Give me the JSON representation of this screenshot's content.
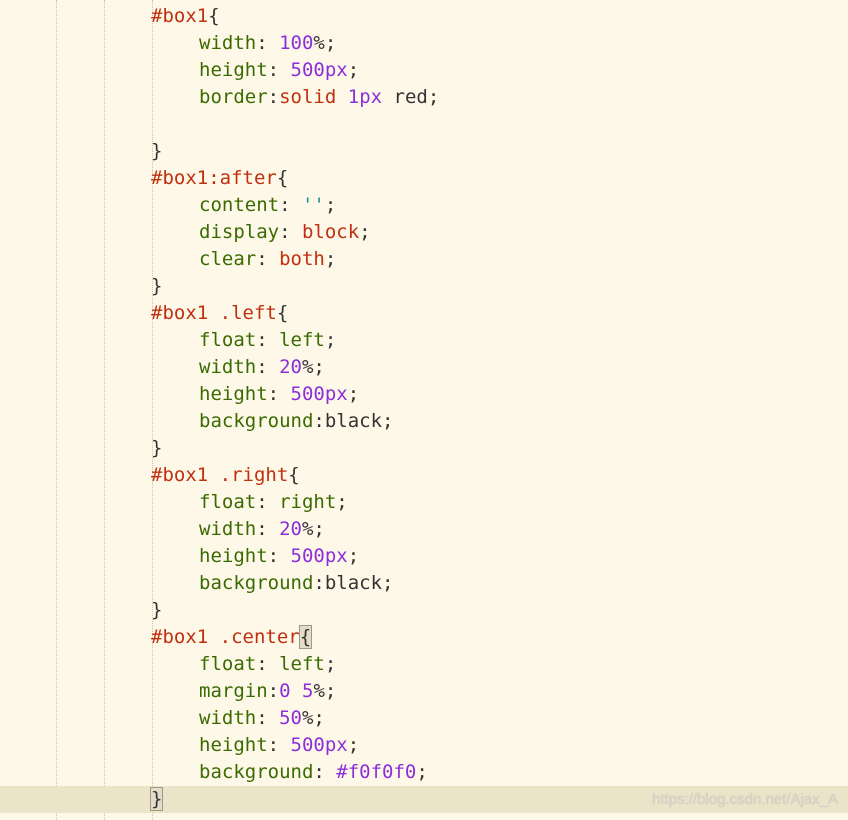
{
  "editor": {
    "lines": [
      {
        "tokens": [
          {
            "t": "sel",
            "v": "#box1"
          },
          {
            "t": "brace",
            "v": "{"
          }
        ]
      },
      {
        "tokens": [
          {
            "t": "prop",
            "v": "width"
          },
          {
            "t": "punct",
            "v": ": "
          },
          {
            "t": "num",
            "v": "100"
          },
          {
            "t": "punct",
            "v": "%;"
          }
        ]
      },
      {
        "tokens": [
          {
            "t": "prop",
            "v": "height"
          },
          {
            "t": "punct",
            "v": ": "
          },
          {
            "t": "num",
            "v": "500px"
          },
          {
            "t": "punct",
            "v": ";"
          }
        ]
      },
      {
        "tokens": [
          {
            "t": "prop",
            "v": "border"
          },
          {
            "t": "punct",
            "v": ":"
          },
          {
            "t": "kw",
            "v": "solid"
          },
          {
            "t": "punct",
            "v": " "
          },
          {
            "t": "num",
            "v": "1px"
          },
          {
            "t": "punct",
            "v": " "
          },
          {
            "t": "plain",
            "v": "red"
          },
          {
            "t": "punct",
            "v": ";"
          }
        ]
      },
      {
        "tokens": []
      },
      {
        "tokens": [
          {
            "t": "brace",
            "v": "}"
          }
        ]
      },
      {
        "tokens": [
          {
            "t": "sel",
            "v": "#box1:after"
          },
          {
            "t": "brace",
            "v": "{"
          }
        ]
      },
      {
        "tokens": [
          {
            "t": "prop",
            "v": "content"
          },
          {
            "t": "punct",
            "v": ": "
          },
          {
            "t": "str",
            "v": "''"
          },
          {
            "t": "punct",
            "v": ";"
          }
        ]
      },
      {
        "tokens": [
          {
            "t": "prop",
            "v": "display"
          },
          {
            "t": "punct",
            "v": ": "
          },
          {
            "t": "kw",
            "v": "block"
          },
          {
            "t": "punct",
            "v": ";"
          }
        ]
      },
      {
        "tokens": [
          {
            "t": "prop",
            "v": "clear"
          },
          {
            "t": "punct",
            "v": ": "
          },
          {
            "t": "kw",
            "v": "both"
          },
          {
            "t": "punct",
            "v": ";"
          }
        ]
      },
      {
        "tokens": [
          {
            "t": "brace",
            "v": "}"
          }
        ]
      },
      {
        "tokens": [
          {
            "t": "sel",
            "v": "#box1 .left"
          },
          {
            "t": "brace",
            "v": "{"
          }
        ]
      },
      {
        "tokens": [
          {
            "t": "prop",
            "v": "float"
          },
          {
            "t": "punct",
            "v": ": "
          },
          {
            "t": "prop",
            "v": "left"
          },
          {
            "t": "punct",
            "v": ";"
          }
        ]
      },
      {
        "tokens": [
          {
            "t": "prop",
            "v": "width"
          },
          {
            "t": "punct",
            "v": ": "
          },
          {
            "t": "num",
            "v": "20"
          },
          {
            "t": "punct",
            "v": "%;"
          }
        ]
      },
      {
        "tokens": [
          {
            "t": "prop",
            "v": "height"
          },
          {
            "t": "punct",
            "v": ": "
          },
          {
            "t": "num",
            "v": "500px"
          },
          {
            "t": "punct",
            "v": ";"
          }
        ]
      },
      {
        "tokens": [
          {
            "t": "prop",
            "v": "background"
          },
          {
            "t": "punct",
            "v": ":"
          },
          {
            "t": "plain",
            "v": "black"
          },
          {
            "t": "punct",
            "v": ";"
          }
        ]
      },
      {
        "tokens": [
          {
            "t": "brace",
            "v": "}"
          }
        ]
      },
      {
        "tokens": [
          {
            "t": "sel",
            "v": "#box1 .right"
          },
          {
            "t": "brace",
            "v": "{"
          }
        ]
      },
      {
        "tokens": [
          {
            "t": "prop",
            "v": "float"
          },
          {
            "t": "punct",
            "v": ": "
          },
          {
            "t": "prop",
            "v": "right"
          },
          {
            "t": "punct",
            "v": ";"
          }
        ]
      },
      {
        "tokens": [
          {
            "t": "prop",
            "v": "width"
          },
          {
            "t": "punct",
            "v": ": "
          },
          {
            "t": "num",
            "v": "20"
          },
          {
            "t": "punct",
            "v": "%;"
          }
        ]
      },
      {
        "tokens": [
          {
            "t": "prop",
            "v": "height"
          },
          {
            "t": "punct",
            "v": ": "
          },
          {
            "t": "num",
            "v": "500px"
          },
          {
            "t": "punct",
            "v": ";"
          }
        ]
      },
      {
        "tokens": [
          {
            "t": "prop",
            "v": "background"
          },
          {
            "t": "punct",
            "v": ":"
          },
          {
            "t": "plain",
            "v": "black"
          },
          {
            "t": "punct",
            "v": ";"
          }
        ]
      },
      {
        "tokens": [
          {
            "t": "brace",
            "v": "}"
          }
        ]
      },
      {
        "tokens": [
          {
            "t": "sel",
            "v": "#box1 .center"
          },
          {
            "t": "match",
            "v": "{"
          }
        ]
      },
      {
        "tokens": [
          {
            "t": "prop",
            "v": "float"
          },
          {
            "t": "punct",
            "v": ": "
          },
          {
            "t": "prop",
            "v": "left"
          },
          {
            "t": "punct",
            "v": ";"
          }
        ]
      },
      {
        "tokens": [
          {
            "t": "prop",
            "v": "margin"
          },
          {
            "t": "punct",
            "v": ":"
          },
          {
            "t": "num",
            "v": "0"
          },
          {
            "t": "punct",
            "v": " "
          },
          {
            "t": "num",
            "v": "5"
          },
          {
            "t": "punct",
            "v": "%;"
          }
        ]
      },
      {
        "tokens": [
          {
            "t": "prop",
            "v": "width"
          },
          {
            "t": "punct",
            "v": ": "
          },
          {
            "t": "num",
            "v": "50"
          },
          {
            "t": "punct",
            "v": "%;"
          }
        ]
      },
      {
        "tokens": [
          {
            "t": "prop",
            "v": "height"
          },
          {
            "t": "punct",
            "v": ": "
          },
          {
            "t": "num",
            "v": "500px"
          },
          {
            "t": "punct",
            "v": ";"
          }
        ]
      },
      {
        "tokens": [
          {
            "t": "prop",
            "v": "background"
          },
          {
            "t": "punct",
            "v": ": "
          },
          {
            "t": "num",
            "v": "#f0f0f0"
          },
          {
            "t": "punct",
            "v": ";"
          }
        ]
      },
      {
        "tokens": [
          {
            "t": "match",
            "v": "}"
          }
        ]
      }
    ],
    "current_line": 29
  },
  "watermark": "https://blog.csdn.net/Ajax_A",
  "colors": {
    "background": "#fdf8e8",
    "current_line": "#ece4c8",
    "selector": "#c0300f",
    "property": "#3a6b00",
    "number": "#8c2fd9",
    "keyword": "#c0300f",
    "string": "#2a8a8a",
    "plain": "#333333"
  }
}
